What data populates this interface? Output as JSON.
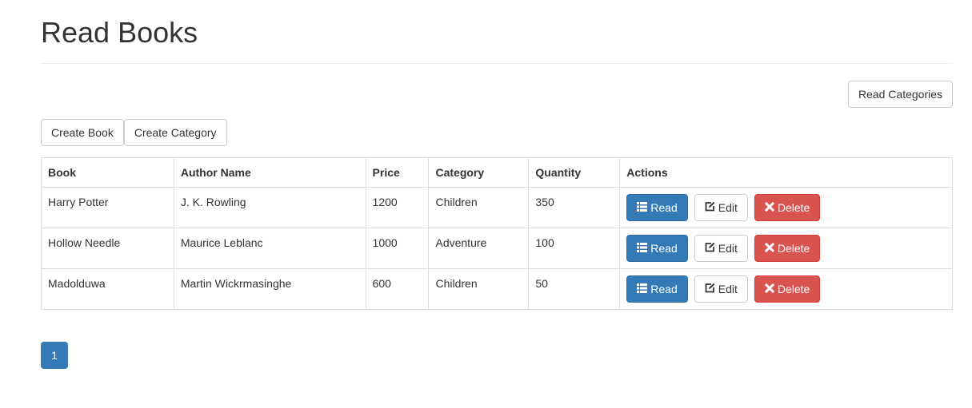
{
  "header": {
    "title": "Read Books"
  },
  "toolbar": {
    "read_categories": "Read Categories",
    "create_book": "Create Book",
    "create_category": "Create Category"
  },
  "table": {
    "columns": [
      "Book",
      "Author Name",
      "Price",
      "Category",
      "Quantity",
      "Actions"
    ],
    "rows": [
      {
        "book": "Harry Potter",
        "author": "J. K. Rowling",
        "price": "1200",
        "category": "Children",
        "quantity": "350"
      },
      {
        "book": "Hollow Needle",
        "author": "Maurice Leblanc",
        "price": "1000",
        "category": "Adventure",
        "quantity": "100"
      },
      {
        "book": "Madolduwa",
        "author": "Martin Wickrmasinghe",
        "price": "600",
        "category": "Children",
        "quantity": "50"
      }
    ],
    "actions": {
      "read": "Read",
      "edit": "Edit",
      "delete": "Delete"
    }
  },
  "pagination": {
    "current": "1"
  },
  "colors": {
    "primary": "#337ab7",
    "danger": "#d9534f",
    "border": "#dddddd",
    "text": "#333333"
  },
  "icons": {
    "read": "list-icon",
    "edit": "edit-icon",
    "delete": "remove-icon"
  }
}
